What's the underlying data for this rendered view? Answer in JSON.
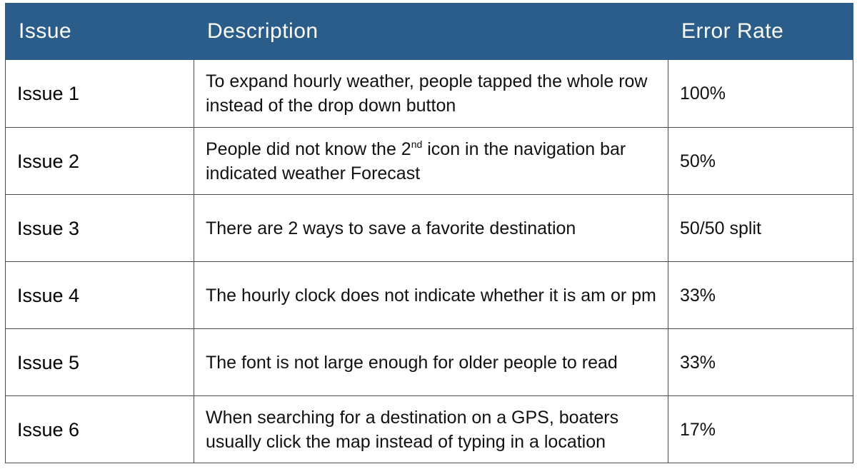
{
  "table": {
    "headers": {
      "issue": "Issue",
      "description": "Description",
      "error_rate": "Error Rate"
    },
    "rows": [
      {
        "issue": "Issue 1",
        "description": "To expand hourly weather, people tapped the whole row instead of the drop down button",
        "error_rate": "100%"
      },
      {
        "issue": "Issue 2",
        "description_before": "People did not know the 2",
        "description_sup": "nd",
        "description_after": " icon in the navigation bar indicated weather Forecast",
        "error_rate": "50%"
      },
      {
        "issue": "Issue 3",
        "description": "There are 2 ways to save a favorite destination",
        "error_rate": "50/50 split"
      },
      {
        "issue": "Issue 4",
        "description": "The hourly clock does not indicate whether it is am or pm",
        "error_rate": "33%"
      },
      {
        "issue": "Issue 5",
        "description": "The font is not large enough for older people to read",
        "error_rate": "33%"
      },
      {
        "issue": "Issue 6",
        "description": "When searching for a destination on a GPS, boaters usually click the map instead of typing in a location",
        "error_rate": "17%"
      }
    ]
  }
}
